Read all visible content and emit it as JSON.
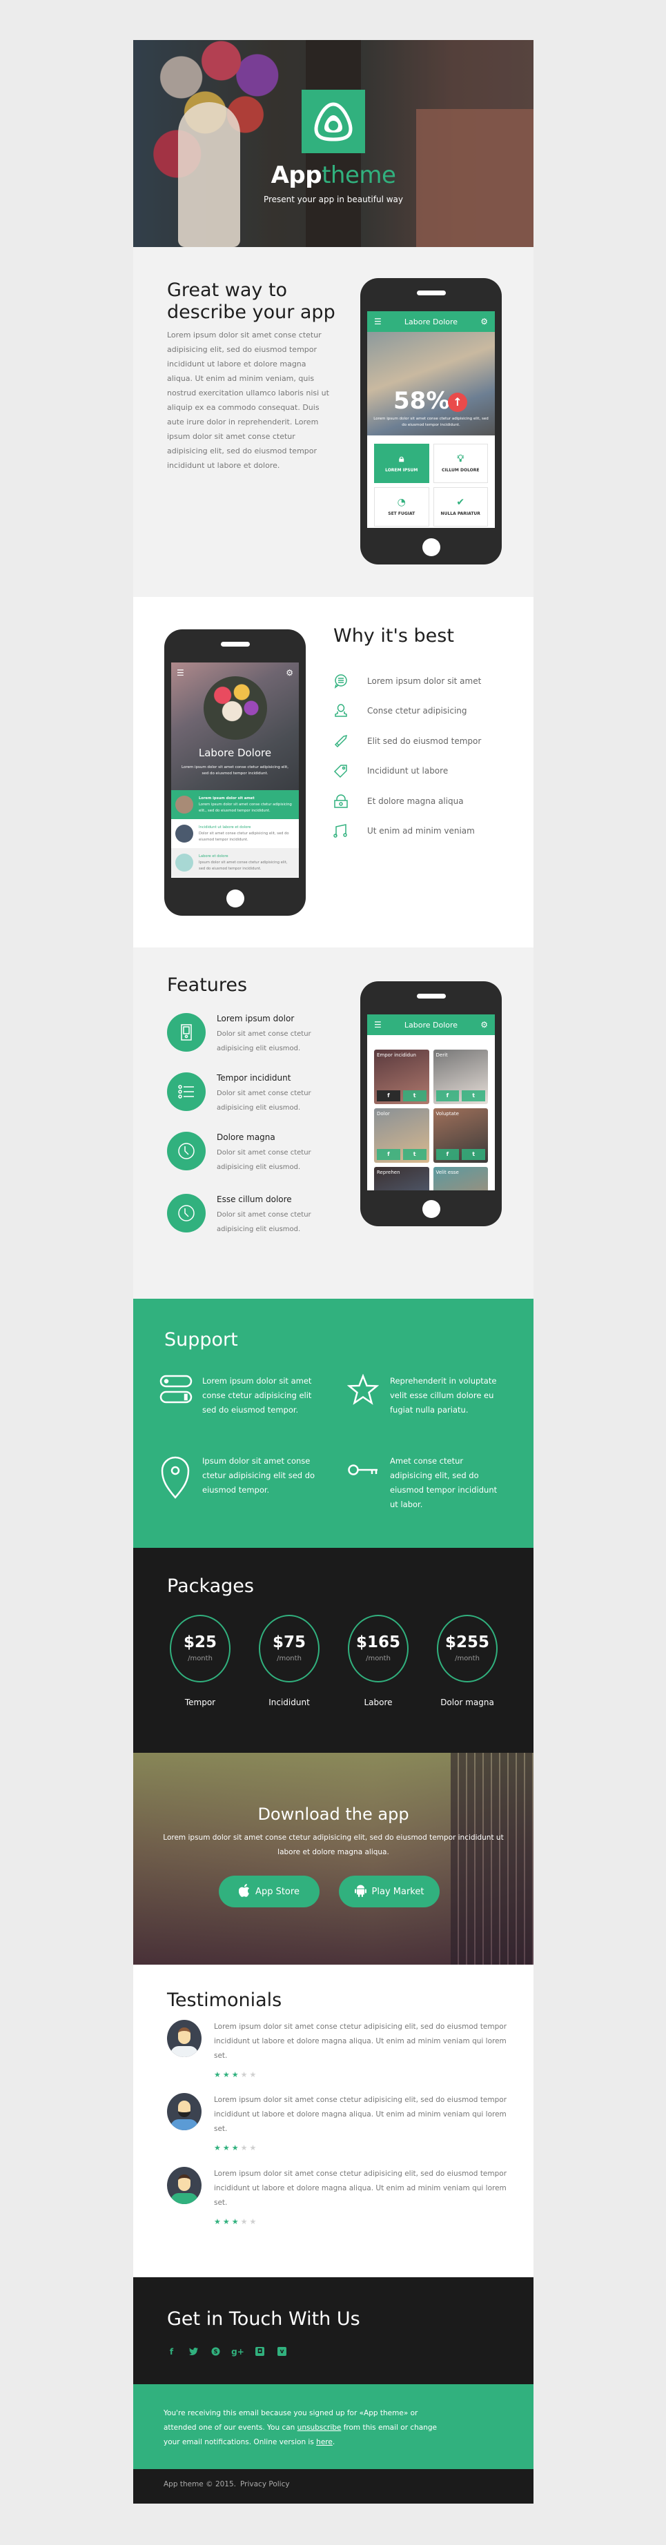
{
  "colors": {
    "accent": "#31b17e",
    "dark": "#1b1b1b",
    "light_bg": "#f2f2f2",
    "alert": "#e94b4b"
  },
  "header": {
    "brand_part1": "App",
    "brand_part2": "theme",
    "tagline": "Present your app in beautiful way",
    "logo_icon": "rounded-triangle-logo-icon"
  },
  "intro": {
    "title": "Great way to describe your app",
    "body": "Lorem ipsum dolor sit amet conse ctetur adipisicing elit, sed do eiusmod tempor incididunt ut labore et dolore magna aliqua. Ut enim ad minim veniam, quis nostrud exercitation ullamco laboris nisi ut aliquip ex ea commodo consequat. Duis aute irure dolor in reprehenderit. Lorem ipsum dolor sit amet conse ctetur adipisicing elit, sed do eiusmod tempor incididunt ut labore et dolore.",
    "phone": {
      "appbar_title": "Labore Dolore",
      "stat_value": "58%",
      "stat_caption": "Lorem ipsum dolor sit amet conse ctetur adipisicing elit, sed do eiusmod tempor incididunt.",
      "tiles": [
        {
          "label": "LOREM IPSUM",
          "icon": "lock-icon",
          "active": true
        },
        {
          "label": "CILLUM DOLORE",
          "icon": "lightbulb-icon",
          "active": false
        },
        {
          "label": "SET FUGIAT",
          "icon": "speedometer-icon",
          "active": false
        },
        {
          "label": "NULLA PARIATUR",
          "icon": "check-circle-icon",
          "active": false
        }
      ]
    }
  },
  "why": {
    "title": "Why it's best",
    "items": [
      {
        "label": "Lorem ipsum dolor sit amet",
        "icon": "chat-bubble-icon"
      },
      {
        "label": "Conse ctetur adipisicing",
        "icon": "user-icon"
      },
      {
        "label": "Elit sed do eiusmod tempor",
        "icon": "pencil-icon"
      },
      {
        "label": "Incididunt ut labore",
        "icon": "tag-icon"
      },
      {
        "label": "Et dolore magna aliqua",
        "icon": "lock-icon"
      },
      {
        "label": "Ut enim ad minim veniam",
        "icon": "music-note-icon"
      }
    ],
    "phone": {
      "title": "Labore Dolore",
      "caption": "Lorem ipsum dolor sit amet conse ctetur adipisicing elit, sed do eiusmod tempor incididunt.",
      "list": [
        {
          "title": "Lorem ipsum dolor sit amet",
          "text": "Lorem ipsum dolor sit amet conse ctetur adipisicing elit., sed do eiusmod tempor incididunt."
        },
        {
          "title": "Incididunt ut labore et dolore",
          "text": "Dolor sit amet conse ctetur adipisicing elit, sed do eiusmod tempor incididunt."
        },
        {
          "title": "Labore et dolore",
          "text": "Ipsum dolor sit amet conse ctetur adipisicing elit, sed do eiusmod tempor incididunt."
        }
      ]
    }
  },
  "features": {
    "title": "Features",
    "items": [
      {
        "title": "Lorem ipsum dolor",
        "text": "Dolor sit amet conse ctetur adipisicing elit eiusmod.",
        "icon": "mobile-device-icon"
      },
      {
        "title": "Tempor incididunt",
        "text": "Dolor sit amet conse ctetur adipisicing elit eiusmod.",
        "icon": "list-icon"
      },
      {
        "title": "Dolore magna",
        "text": "Dolor sit amet conse ctetur adipisicing elit eiusmod.",
        "icon": "clock-icon"
      },
      {
        "title": "Esse cillum dolore",
        "text": "Dolor sit amet conse ctetur adipisicing elit eiusmod.",
        "icon": "clock-icon"
      }
    ],
    "phone": {
      "appbar_title": "Labore Dolore",
      "cards": [
        {
          "name": "Empor incididun"
        },
        {
          "name": "Derit"
        },
        {
          "name": "Dolor"
        },
        {
          "name": "Voluptate"
        },
        {
          "name": "Reprehen"
        },
        {
          "name": "Velit esse"
        }
      ],
      "facebook_glyph": "f",
      "twitter_glyph": "t"
    }
  },
  "support": {
    "title": "Support",
    "items": [
      {
        "text": "Lorem ipsum dolor sit amet conse ctetur adipisicing elit sed do eiusmod tempor.",
        "icon": "toggles-icon"
      },
      {
        "text": "Reprehenderit in voluptate velit esse cillum dolore eu fugiat nulla pariatu.",
        "icon": "star-icon"
      },
      {
        "text": "Ipsum dolor sit amet conse ctetur adipisicing elit sed do eiusmod tempor.",
        "icon": "map-pin-icon"
      },
      {
        "text": "Amet conse ctetur adipisicing elit, sed do eiusmod tempor incididunt ut labor.",
        "icon": "key-icon"
      }
    ]
  },
  "packages": {
    "title": "Packages",
    "items": [
      {
        "price": "$25",
        "period": "/month",
        "name": "Tempor"
      },
      {
        "price": "$75",
        "period": "/month",
        "name": "Incididunt"
      },
      {
        "price": "$165",
        "period": "/month",
        "name": "Labore"
      },
      {
        "price": "$255",
        "period": "/month",
        "name": "Dolor magna"
      }
    ]
  },
  "download": {
    "title": "Download the app",
    "text": "Lorem ipsum dolor sit amet conse ctetur adipisicing elit, sed do eiusmod tempor incididunt ut labore et dolore magna aliqua.",
    "app_store_label": "App Store",
    "play_market_label": "Play Market"
  },
  "testimonials": {
    "title": "Testimonials",
    "items": [
      {
        "text": "Lorem ipsum dolor sit amet conse ctetur adipisicing elit, sed do eiusmod tempor incididunt ut labore et dolore magna aliqua. Ut enim ad minim veniam qui lorem set.",
        "rating": 3,
        "max": 5
      },
      {
        "text": "Lorem ipsum dolor sit amet conse ctetur adipisicing elit, sed do eiusmod tempor incididunt ut labore et dolore magna aliqua. Ut enim ad minim veniam qui lorem set.",
        "rating": 3,
        "max": 5
      },
      {
        "text": "Lorem ipsum dolor sit amet conse ctetur adipisicing elit, sed do eiusmod tempor incididunt ut labore et dolore magna aliqua. Ut enim ad minim veniam qui lorem set.",
        "rating": 3,
        "max": 5
      }
    ]
  },
  "contact": {
    "title": "Get in Touch With Us",
    "social": [
      "facebook-icon",
      "twitter-icon",
      "skype-icon",
      "google-plus-icon",
      "instagram-icon",
      "vimeo-icon"
    ]
  },
  "notice": {
    "text_before": "You're receiving this email because you signed up for «App theme» or attended one of our events. You can ",
    "unsubscribe_label": "unsubscribe",
    "text_middle": " from this email or change your email notifications. Online version is ",
    "here_label": "here",
    "text_after": "."
  },
  "footer": {
    "copyright": "App theme © 2015.",
    "privacy_label": "Privacy Policy"
  }
}
